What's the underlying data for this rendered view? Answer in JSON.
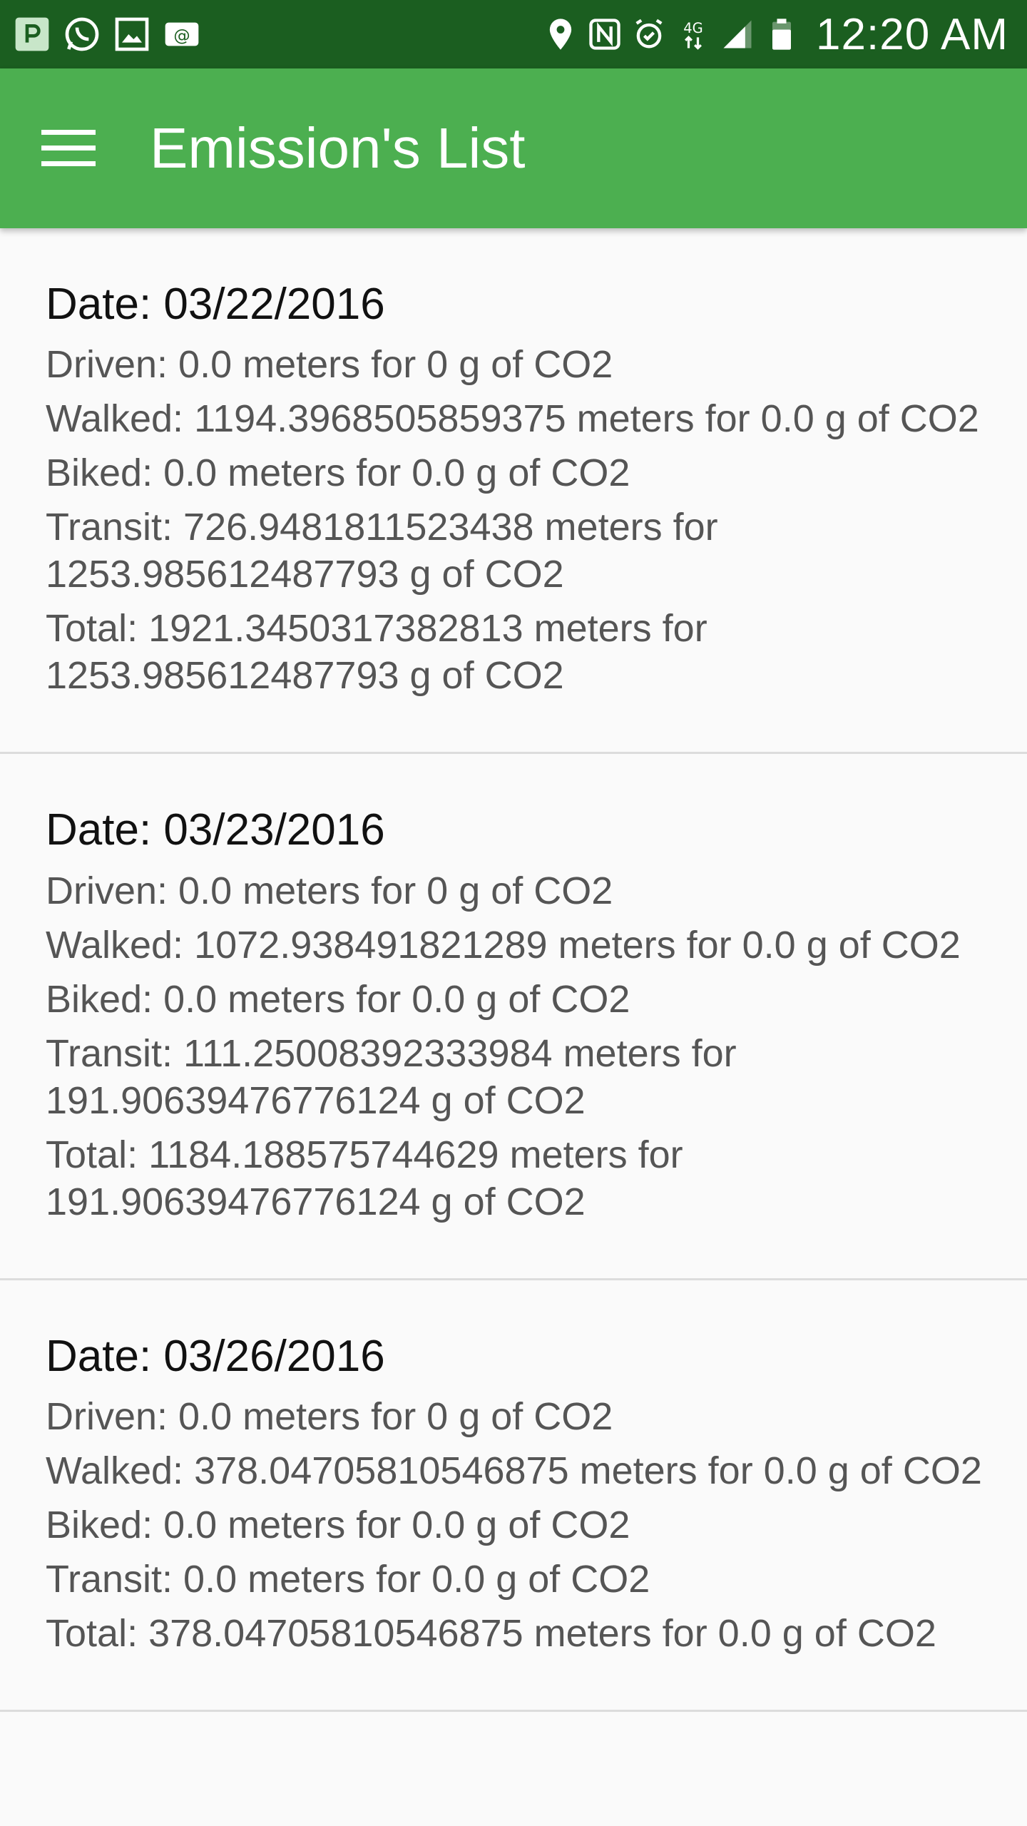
{
  "status_bar": {
    "left_icons": [
      "p-app-icon",
      "whatsapp-icon",
      "gallery-icon",
      "email-icon"
    ],
    "right_icons": [
      "location-icon",
      "nfc-icon",
      "alarm-icon",
      "4g-lte-icon",
      "signal-icon",
      "battery-icon"
    ],
    "network_label": "4G",
    "time": "12:20 AM"
  },
  "app_bar": {
    "title": "Emission's List",
    "menu_icon": "hamburger-menu-icon"
  },
  "colors": {
    "status_bar": "#1b5e20",
    "app_bar": "#4caf50",
    "background": "#fafafa"
  },
  "entries": [
    {
      "date": "Date: 03/22/2016",
      "driven": "Driven: 0.0 meters for 0 g of CO2",
      "walked": "Walked: 1194.3968505859375 meters for 0.0 g of CO2",
      "biked": "Biked: 0.0 meters for 0.0 g of CO2",
      "transit": "Transit: 726.9481811523438 meters for 1253.985612487793 g of CO2",
      "total": "Total: 1921.3450317382813 meters for 1253.985612487793 g of CO2"
    },
    {
      "date": "Date: 03/23/2016",
      "driven": "Driven: 0.0 meters for 0 g of CO2",
      "walked": "Walked: 1072.938491821289 meters for 0.0 g of CO2",
      "biked": "Biked: 0.0 meters for 0.0 g of CO2",
      "transit": "Transit: 111.25008392333984 meters for 191.90639476776124 g of CO2",
      "total": "Total: 1184.188575744629 meters for 191.90639476776124 g of CO2"
    },
    {
      "date": "Date: 03/26/2016",
      "driven": "Driven: 0.0 meters for 0 g of CO2",
      "walked": "Walked: 378.04705810546875 meters for 0.0 g of CO2",
      "biked": "Biked: 0.0 meters for 0.0 g of CO2",
      "transit": "Transit: 0.0 meters for 0.0 g of CO2",
      "total": "Total: 378.04705810546875 meters for 0.0 g of CO2"
    }
  ]
}
